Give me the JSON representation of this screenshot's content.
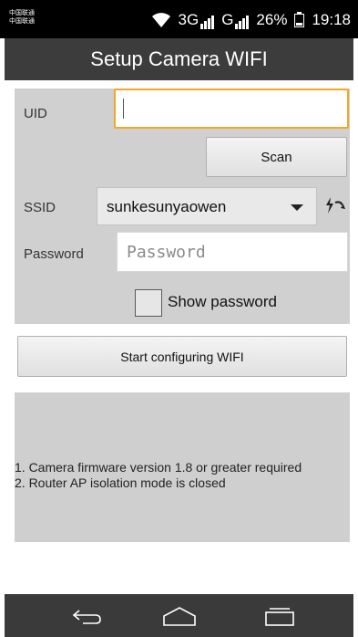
{
  "status_bar": {
    "carrier_line1": "中国联通",
    "carrier_line2": "中国联通",
    "net1": "3G",
    "net2": "G",
    "battery": "26%",
    "time": "19:18"
  },
  "app_bar": {
    "title": "Setup Camera WIFI"
  },
  "form": {
    "uid_label": "UID",
    "uid_value": "",
    "scan_label": "Scan",
    "ssid_label": "SSID",
    "ssid_value": "sunkesunyaowen",
    "password_label": "Password",
    "password_placeholder": "Password",
    "show_password_label": "Show password",
    "show_password_checked": false
  },
  "start_button_label": "Start configuring WIFI",
  "info": {
    "line1": "1. Camera firmware version 1.8 or greater required",
    "line2": "2. Router AP isolation mode is closed"
  },
  "nav": {
    "icons": [
      "back-icon",
      "home-icon",
      "recents-icon"
    ]
  },
  "colors": {
    "accent": "#f5a623",
    "app_bar": "#3c3c3c",
    "panel": "#d0d0d0"
  }
}
